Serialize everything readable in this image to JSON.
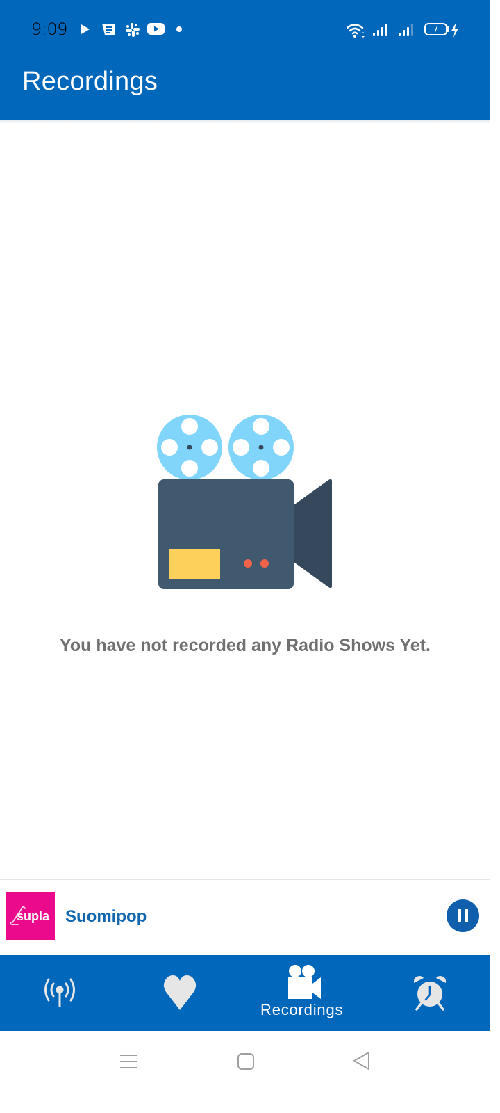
{
  "status_bar": {
    "time": "9:09",
    "notification_icons": [
      "play-icon",
      "message-icon",
      "slack-icon",
      "youtube-icon",
      "dot-icon"
    ],
    "system_icons": [
      "wifi-icon",
      "signal-1-icon",
      "signal-2-icon"
    ],
    "battery_level": "7",
    "charging": true
  },
  "app_bar": {
    "title": "Recordings"
  },
  "empty_state": {
    "illustration": "movie-camera-illustration",
    "message": "You have not recorded any Radio Shows Yet."
  },
  "mini_player": {
    "logo_text": "supla",
    "station_name": "Suomipop",
    "control": "pause"
  },
  "bottom_nav": {
    "items": [
      {
        "id": "live",
        "icon": "broadcast-icon",
        "label": ""
      },
      {
        "id": "favorites",
        "icon": "heart-icon",
        "label": ""
      },
      {
        "id": "recordings",
        "icon": "video-camera-icon",
        "label": "Recordings",
        "active": true
      },
      {
        "id": "alarm",
        "icon": "alarm-clock-icon",
        "label": ""
      }
    ]
  },
  "colors": {
    "primary": "#0167bb",
    "station_name": "#1266b0",
    "logo_bg": "#eb0a8c",
    "message_text": "#707070",
    "reel": "#81d4fa",
    "camera_body": "#41596e",
    "camera_lens": "#35485c",
    "label_yellow": "#fcd05a",
    "led_red": "#f1624a"
  }
}
